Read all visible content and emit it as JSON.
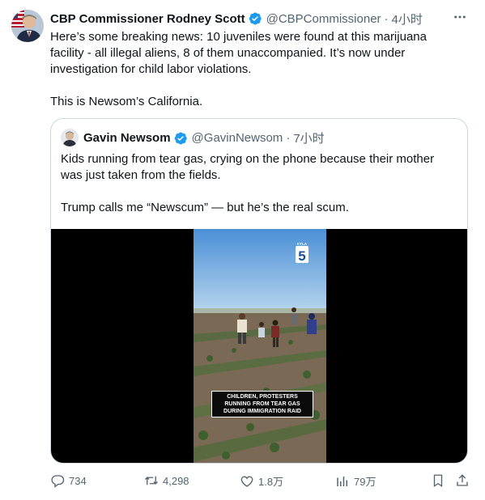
{
  "tweet": {
    "author_name": "CBP Commissioner Rodney Scott",
    "handle": "@CBPCommissioner",
    "separator": "·",
    "time": "4小时",
    "text": "Here’s some breaking news: 10 juveniles were found at this marijuana facility - all illegal aliens, 8 of them unaccompanied. It’s  now under investigation for child labor violations.\n\nThis is Newsom’s California."
  },
  "quote": {
    "author_name": "Gavin Newsom",
    "handle": "@GavinNewsom",
    "separator": "·",
    "time": "7小时",
    "text": "Kids running from tear gas, crying on the phone because their mother was just taken from the fields.\n\nTrump calls me “Newscum” — but he’s the real scum.",
    "video_caption": "CHILDREN, PROTESTERS RUNNING FROM TEAR GAS DURING IMMIGRATION RAID",
    "channel_logo_text": "KTLA",
    "channel_logo_number": "5"
  },
  "actions": {
    "replies": "734",
    "reposts": "4,298",
    "likes": "1.8万",
    "views": "79万"
  },
  "icons": {
    "verified": "verified-badge-icon",
    "more": "more-icon",
    "reply": "reply-icon",
    "repost": "repost-icon",
    "like": "like-icon",
    "views": "views-icon",
    "bookmark": "bookmark-icon",
    "share": "share-icon"
  },
  "colors": {
    "verified": "#1d9bf0",
    "secondary_text": "#536471",
    "border": "#cfd9de"
  }
}
